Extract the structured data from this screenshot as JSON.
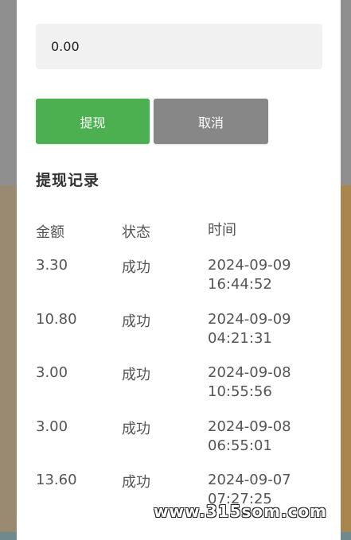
{
  "withdraw_form": {
    "amount_value": "0.00",
    "withdraw_label": "提现",
    "cancel_label": "取消"
  },
  "records": {
    "title": "提现记录",
    "headers": {
      "amount": "金额",
      "status": "状态",
      "time": "时间"
    },
    "rows": [
      {
        "amount": "3.30",
        "status": "成功",
        "date": "2024-09-09",
        "clock": "16:44:52"
      },
      {
        "amount": "10.80",
        "status": "成功",
        "date": "2024-09-09",
        "clock": "04:21:31"
      },
      {
        "amount": "3.00",
        "status": "成功",
        "date": "2024-09-08",
        "clock": "10:55:56"
      },
      {
        "amount": "3.00",
        "status": "成功",
        "date": "2024-09-08",
        "clock": "06:55:01"
      },
      {
        "amount": "13.60",
        "status": "成功",
        "date": "2024-09-07",
        "clock": "07:27:25"
      }
    ]
  },
  "watermark": "www.315som.com",
  "colors": {
    "withdraw_button": "#4caf50",
    "cancel_button": "#878787"
  }
}
